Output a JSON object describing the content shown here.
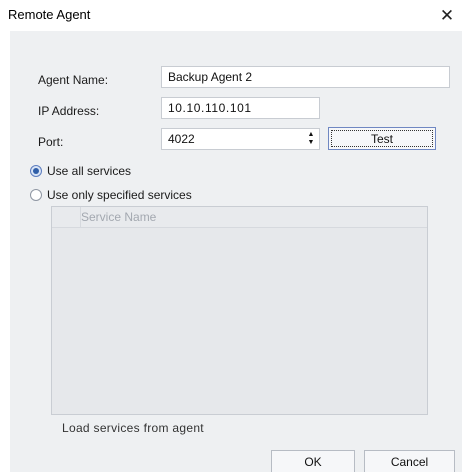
{
  "window": {
    "title": "Remote Agent",
    "close_glyph": "✕"
  },
  "form": {
    "agent_name_label": "Agent Name:",
    "agent_name_value": "Backup Agent 2",
    "ip_address_label": "IP Address:",
    "ip_address_value": "10.10.110.101",
    "port_label": "Port:",
    "port_value": "4022",
    "spin_up": "▲",
    "spin_down": "▼",
    "test_button": "Test"
  },
  "services": {
    "option_all": "Use all services",
    "option_specified": "Use only specified services",
    "selected": "option_all",
    "grid_column": "Service Name",
    "load_link": "Load services from agent"
  },
  "buttons": {
    "ok": "OK",
    "cancel": "Cancel"
  },
  "icons": {
    "close": "close-icon",
    "spin_up": "chevron-up-icon",
    "spin_down": "chevron-down-icon"
  }
}
